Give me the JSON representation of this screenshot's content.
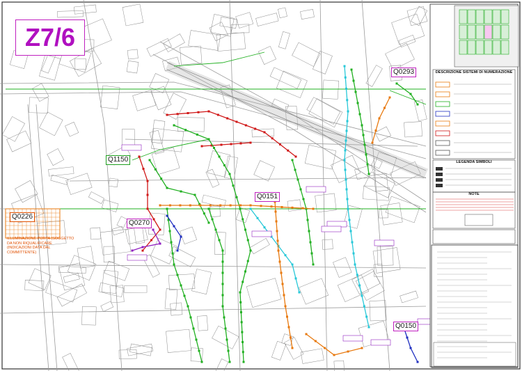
{
  "zone": "Z7/6",
  "labels": {
    "q0293": "Q0293",
    "q1150": "Q1150",
    "q0151": "Q0151",
    "q0226": "Q0226",
    "q0270": "Q0270",
    "q0150": "Q0150"
  },
  "note": "ILLUMINAZIONE PORTA (SOGGETTO DA NON RIQUALIFICARE (INDICAZIONI DATA DAL COMMITTENTE)",
  "legend": {
    "title1": "DESCRIZIONE SISTEMI DI NUMERAZIONE",
    "title2": "LEGENDA SIMBOLI",
    "title3": "NOTE"
  },
  "colors": {
    "zone": "#b010c0",
    "green": "#22b022",
    "red": "#d01818",
    "cyan": "#28c8d8",
    "orange": "#e87a10",
    "blue": "#2030c0",
    "purple": "#9020c0"
  }
}
